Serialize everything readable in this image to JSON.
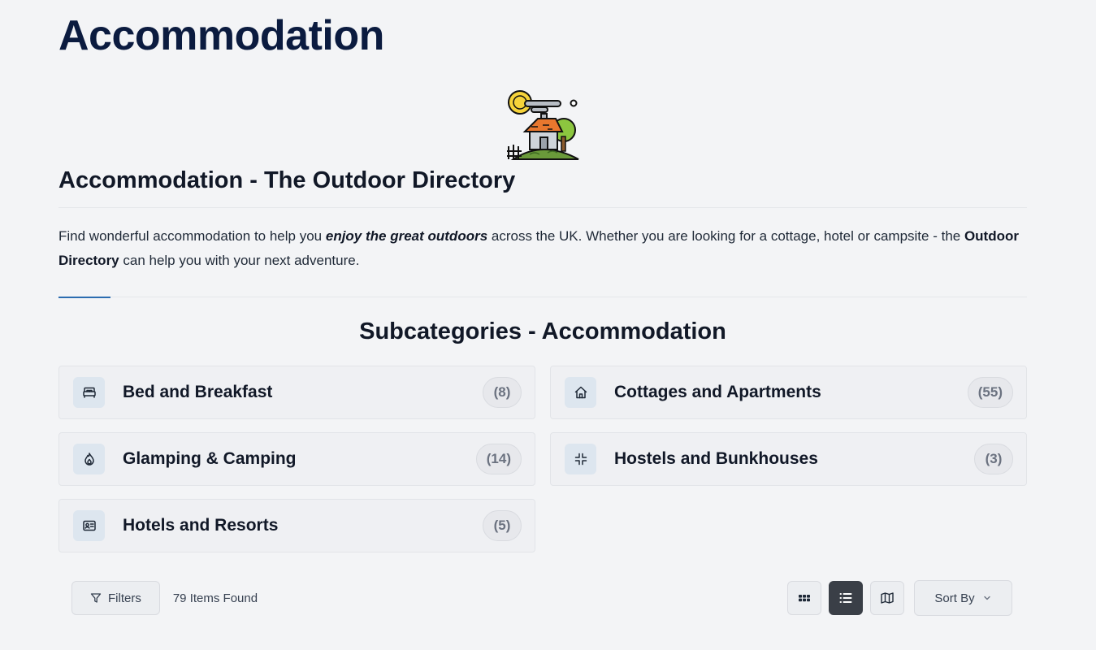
{
  "page": {
    "title": "Accommodation"
  },
  "hero": {
    "icon": "cottage-illustration-icon"
  },
  "directory": {
    "heading": "Accommodation - The Outdoor Directory",
    "intro_part1": "Find wonderful accommodation to help you ",
    "intro_emphasis": "enjoy the great outdoors",
    "intro_part2": " across the UK. Whether you are looking for a cottage, hotel or campsite  - the ",
    "intro_strong": "Outdoor Directory",
    "intro_part3": " can help you with your next adventure."
  },
  "subcategories": {
    "heading": "Subcategories - Accommodation",
    "items": [
      {
        "name": "Bed and Breakfast",
        "count": "(8)",
        "icon": "bed-icon"
      },
      {
        "name": "Cottages and Apartments",
        "count": "(55)",
        "icon": "house-icon"
      },
      {
        "name": "Glamping & Camping",
        "count": "(14)",
        "icon": "flame-icon"
      },
      {
        "name": "Hostels and Bunkhouses",
        "count": "(3)",
        "icon": "minimize-icon"
      },
      {
        "name": "Hotels and Resorts",
        "count": "(5)",
        "icon": "id-card-icon"
      }
    ]
  },
  "toolbar": {
    "filters_label": "Filters",
    "items_found": "79 Items Found",
    "sort_label": "Sort By",
    "active_view": "list"
  },
  "colors": {
    "page_bg": "#f3f4f6",
    "title": "#0b1b3f",
    "accent_rule": "#2b6cb0",
    "active_view_bg": "#3a3f47",
    "icon_tile_bg": "#dde6ef"
  }
}
